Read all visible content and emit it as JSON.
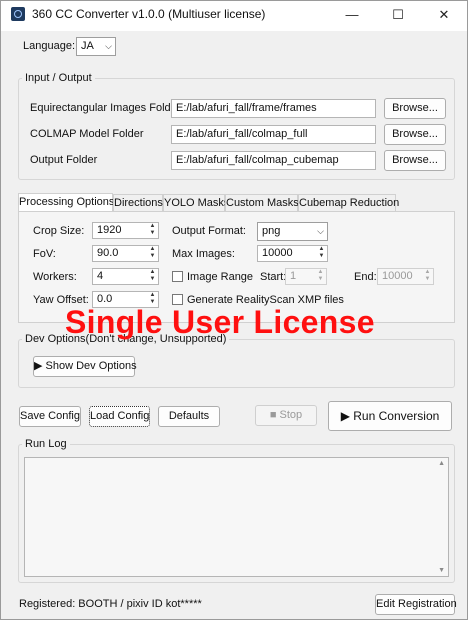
{
  "window": {
    "title": "360 CC Converter v1.0.0 (Multiuser license)",
    "minimize": "—",
    "maximize": "☐",
    "close": "✕"
  },
  "language": {
    "label": "Language:",
    "value": "JA",
    "arrow": "⌵"
  },
  "io": {
    "title": "Input / Output",
    "rows": [
      {
        "label": "Equirectangular Images Folder",
        "value": "E:/lab/afuri_fall/frame/frames",
        "button": "Browse..."
      },
      {
        "label": "COLMAP Model Folder",
        "value": "E:/lab/afuri_fall/colmap_full",
        "button": "Browse..."
      },
      {
        "label": "Output Folder",
        "value": "E:/lab/afuri_fall/colmap_cubemap",
        "button": "Browse..."
      }
    ]
  },
  "tabs": [
    "Processing Options",
    "Directions",
    "YOLO Masks",
    "Custom Masks",
    "Cubemap Reduction"
  ],
  "processing": {
    "crop_size": {
      "label": "Crop Size:",
      "value": "1920"
    },
    "fov": {
      "label": "FoV:",
      "value": "90.0"
    },
    "workers": {
      "label": "Workers:",
      "value": "4"
    },
    "yaw_offset": {
      "label": "Yaw Offset:",
      "value": "0.0"
    },
    "output_format": {
      "label": "Output Format:",
      "value": "png"
    },
    "max_images": {
      "label": "Max Images:",
      "value": "10000"
    },
    "image_range": {
      "label": "Image Range",
      "checked": false
    },
    "start": {
      "label": "Start:",
      "value": "1"
    },
    "end": {
      "label": "End:",
      "value": "10000"
    },
    "xmp": {
      "label": "Generate RealityScan XMP files",
      "checked": false
    }
  },
  "watermark": "Single User License",
  "dev": {
    "title": "Dev Options(Don't change, Unsupported)",
    "button": "▶ Show Dev Options"
  },
  "actions": {
    "save": "Save Config",
    "load": "Load Config",
    "defaults": "Defaults",
    "stop": "■ Stop",
    "run": "▶ Run Conversion"
  },
  "log": {
    "title": "Run Log",
    "up": "▲",
    "down": "▼"
  },
  "footer": {
    "registered": "Registered: BOOTH / pixiv ID kot*****",
    "edit": "Edit Registration"
  }
}
